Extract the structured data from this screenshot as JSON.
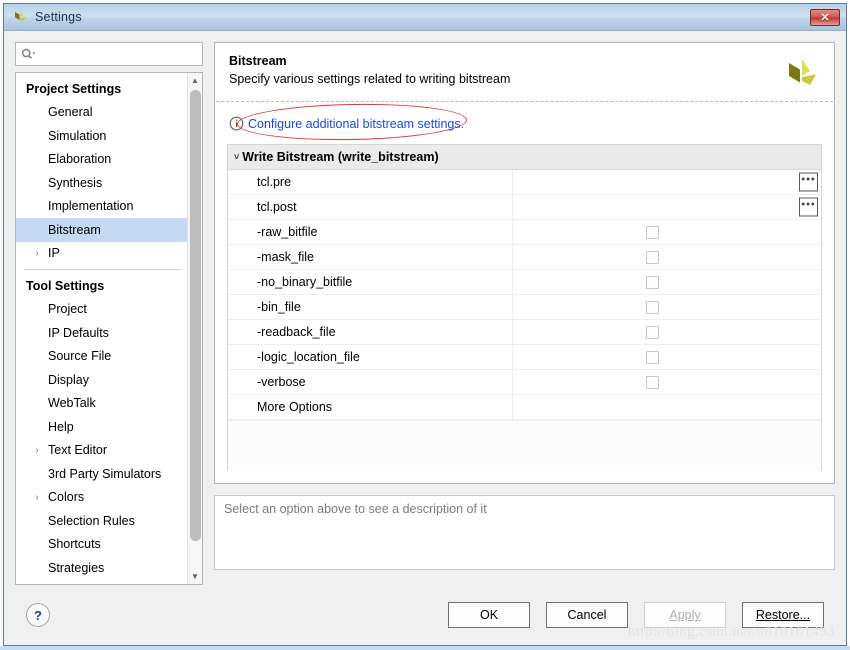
{
  "window": {
    "title": "Settings",
    "icon": "xilinx-logo-icon",
    "close_label": "✕"
  },
  "sidebar": {
    "search": {
      "placeholder": "",
      "value": "",
      "icon": "search-icon"
    },
    "groups": [
      {
        "label": "Project Settings",
        "items": [
          {
            "label": "General",
            "expandable": false,
            "selected": false
          },
          {
            "label": "Simulation",
            "expandable": false,
            "selected": false
          },
          {
            "label": "Elaboration",
            "expandable": false,
            "selected": false
          },
          {
            "label": "Synthesis",
            "expandable": false,
            "selected": false
          },
          {
            "label": "Implementation",
            "expandable": false,
            "selected": false
          },
          {
            "label": "Bitstream",
            "expandable": false,
            "selected": true
          },
          {
            "label": "IP",
            "expandable": true,
            "selected": false
          }
        ]
      },
      {
        "label": "Tool Settings",
        "items": [
          {
            "label": "Project",
            "expandable": false,
            "selected": false
          },
          {
            "label": "IP Defaults",
            "expandable": false,
            "selected": false
          },
          {
            "label": "Source File",
            "expandable": false,
            "selected": false
          },
          {
            "label": "Display",
            "expandable": false,
            "selected": false
          },
          {
            "label": "WebTalk",
            "expandable": false,
            "selected": false
          },
          {
            "label": "Help",
            "expandable": false,
            "selected": false
          },
          {
            "label": "Text Editor",
            "expandable": true,
            "selected": false
          },
          {
            "label": "3rd Party Simulators",
            "expandable": false,
            "selected": false
          },
          {
            "label": "Colors",
            "expandable": true,
            "selected": false
          },
          {
            "label": "Selection Rules",
            "expandable": false,
            "selected": false
          },
          {
            "label": "Shortcuts",
            "expandable": false,
            "selected": false
          },
          {
            "label": "Strategies",
            "expandable": false,
            "selected": false
          }
        ]
      }
    ],
    "scroll_up_icon": "chevron-up-icon",
    "scroll_down_icon": "chevron-down-icon",
    "expand_arrow": "›"
  },
  "main": {
    "title": "Bitstream",
    "subtitle": "Specify various settings related to writing bitstream",
    "logo": "xilinx-logo-icon",
    "info_icon": "info-icon",
    "config_link": "Configure additional bitstream settings.",
    "annotation": {
      "shape": "ellipse",
      "color": "#e8362d"
    },
    "table": {
      "section_label": "Write Bitstream (write_bitstream)",
      "collapse_icon": "˅",
      "rows": [
        {
          "name": "tcl.pre",
          "control": "browse",
          "value": "",
          "button_label": "•••"
        },
        {
          "name": "tcl.post",
          "control": "browse",
          "value": "",
          "button_label": "•••"
        },
        {
          "name": "-raw_bitfile",
          "control": "checkbox",
          "checked": false
        },
        {
          "name": "-mask_file",
          "control": "checkbox",
          "checked": false
        },
        {
          "name": "-no_binary_bitfile",
          "control": "checkbox",
          "checked": false
        },
        {
          "name": "-bin_file",
          "control": "checkbox",
          "checked": false
        },
        {
          "name": "-readback_file",
          "control": "checkbox",
          "checked": false
        },
        {
          "name": "-logic_location_file",
          "control": "checkbox",
          "checked": false
        },
        {
          "name": "-verbose",
          "control": "checkbox",
          "checked": false
        },
        {
          "name": "More Options",
          "control": "none"
        }
      ]
    },
    "description_placeholder": "Select an option above to see a description of it"
  },
  "footer": {
    "help_label": "?",
    "buttons": [
      {
        "label": "OK",
        "enabled": true,
        "mnemonic_index": -1
      },
      {
        "label": "Cancel",
        "enabled": true,
        "mnemonic_index": -1
      },
      {
        "label": "Apply",
        "enabled": false,
        "mnemonic_index": 0
      },
      {
        "label": "Restore...",
        "enabled": true,
        "mnemonic_index": 0
      }
    ]
  },
  "watermark": "http://blog.csdn.net/u010161493"
}
